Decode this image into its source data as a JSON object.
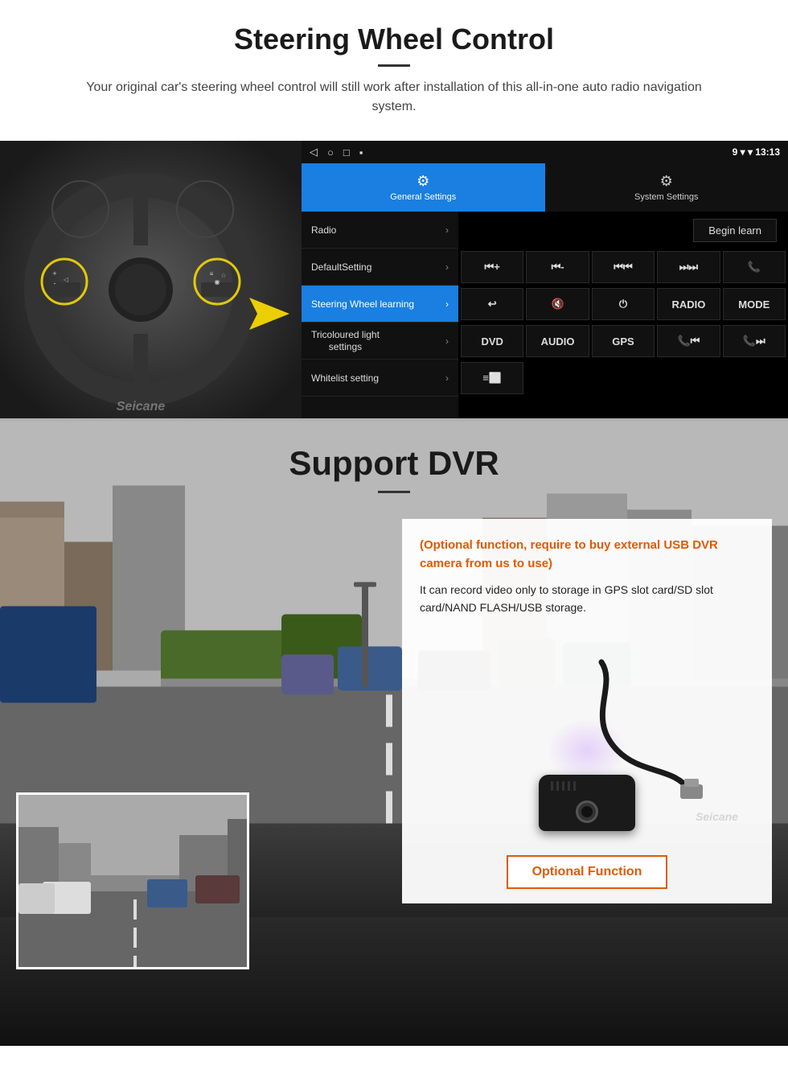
{
  "page": {
    "section1": {
      "title": "Steering Wheel Control",
      "subtitle": "Your original car's steering wheel control will still work after installation of this all-in-one auto radio navigation system.",
      "android": {
        "statusbar": {
          "nav_icons": [
            "◁",
            "○",
            "□",
            "▪"
          ],
          "signal": "▾",
          "wifi": "▾",
          "time": "13:13"
        },
        "tabs": [
          {
            "label": "General Settings",
            "icon": "⚙",
            "active": true
          },
          {
            "label": "System Settings",
            "icon": "🔧",
            "active": false
          }
        ],
        "menu_items": [
          {
            "label": "Radio",
            "active": false
          },
          {
            "label": "DefaultSetting",
            "active": false
          },
          {
            "label": "Steering Wheel learning",
            "active": true
          },
          {
            "label": "Tricoloured light settings",
            "active": false
          },
          {
            "label": "Whitelist setting",
            "active": false
          }
        ],
        "begin_learn": "Begin learn",
        "control_buttons": [
          {
            "label": "⏮+",
            "row": 1
          },
          {
            "label": "⏮-",
            "row": 1
          },
          {
            "label": "⏮⏮",
            "row": 1
          },
          {
            "label": "⏭⏭",
            "row": 1
          },
          {
            "label": "📞",
            "row": 1
          },
          {
            "label": "↩",
            "row": 2
          },
          {
            "label": "🔇",
            "row": 2
          },
          {
            "label": "⏻",
            "row": 2
          },
          {
            "label": "RADIO",
            "row": 2
          },
          {
            "label": "MODE",
            "row": 2
          },
          {
            "label": "DVD",
            "row": 3
          },
          {
            "label": "AUDIO",
            "row": 3
          },
          {
            "label": "GPS",
            "row": 3
          },
          {
            "label": "📞⏮",
            "row": 3
          },
          {
            "label": "📞⏭",
            "row": 3
          },
          {
            "label": "≡",
            "row": 4
          }
        ]
      }
    },
    "section2": {
      "title": "Support DVR",
      "optional_heading": "(Optional function, require to buy external USB DVR camera from us to use)",
      "description": "It can record video only to storage in GPS slot card/SD slot card/NAND FLASH/USB storage.",
      "optional_button": "Optional Function",
      "seicane": "Seicane"
    }
  }
}
